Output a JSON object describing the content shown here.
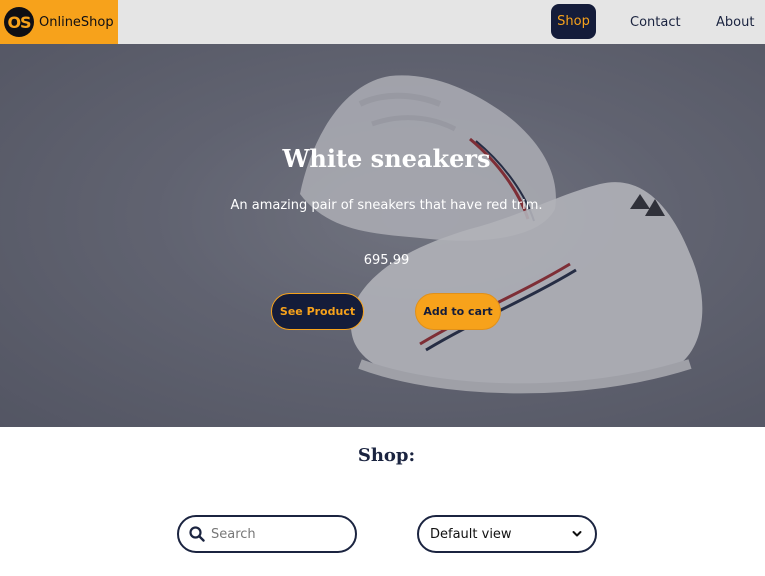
{
  "navbar": {
    "brand_badge": "OS",
    "brand_name": "OnlineShop",
    "links": [
      {
        "label": "Shop",
        "active": true
      },
      {
        "label": "Contact",
        "active": false
      },
      {
        "label": "About",
        "active": false
      }
    ]
  },
  "hero": {
    "title": "White sneakers",
    "description": "An amazing pair of sneakers that have red trim.",
    "price": "695.99",
    "see_product_label": "See Product",
    "add_to_cart_label": "Add to cart"
  },
  "shop": {
    "heading": "Shop:",
    "search": {
      "placeholder": "Search",
      "value": ""
    },
    "view_select": {
      "selected": "Default view"
    }
  },
  "icons": {
    "search": "search-icon",
    "chevron": "chevron-down-icon"
  },
  "colors": {
    "accent": "#f7a21b",
    "navy": "#141c3a",
    "navbar_bg": "#e5e5e5"
  }
}
